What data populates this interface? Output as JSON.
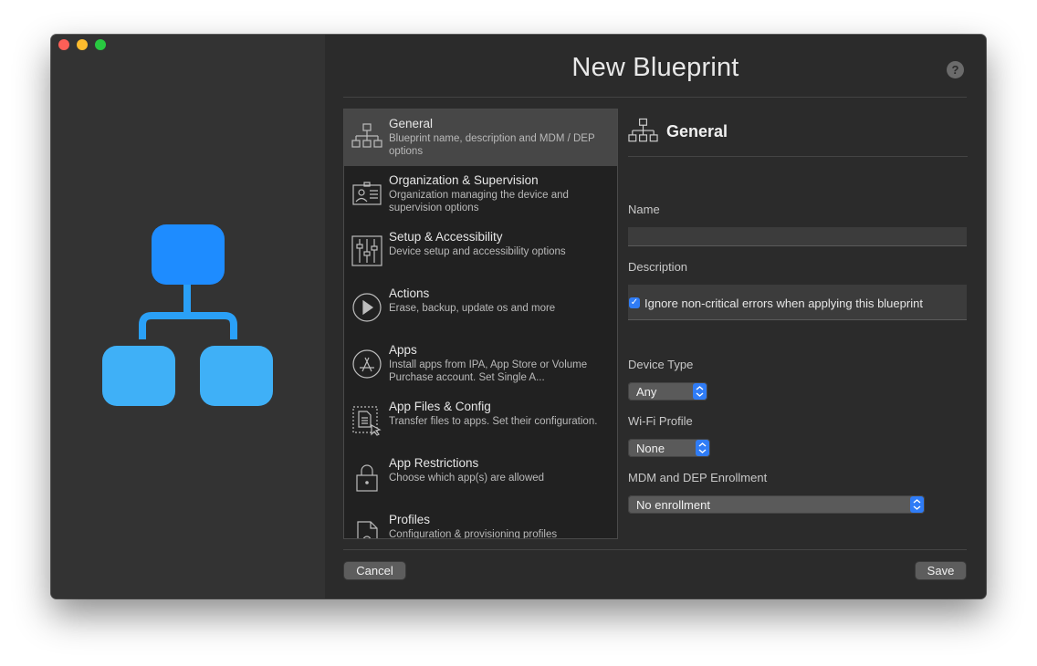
{
  "window": {
    "title": "New Blueprint",
    "help_label": "?"
  },
  "sidebar": {
    "items": [
      {
        "title": "General",
        "description": "Blueprint name, description and MDM / DEP options",
        "icon": "hierarchy-icon",
        "selected": true
      },
      {
        "title": "Organization & Supervision",
        "description": "Organization managing the device and supervision options",
        "icon": "id-card-icon"
      },
      {
        "title": "Setup & Accessibility",
        "description": "Device setup and accessibility options",
        "icon": "sliders-icon"
      },
      {
        "title": "Actions",
        "description": "Erase, backup, update os and more",
        "icon": "play-icon"
      },
      {
        "title": "Apps",
        "description": "Install apps from IPA, App Store or Volume Purchase account. Set Single A...",
        "icon": "app-store-icon"
      },
      {
        "title": "App Files & Config",
        "description": "Transfer files to apps. Set their configuration.",
        "icon": "file-transfer-icon"
      },
      {
        "title": "App Restrictions",
        "description": "Choose which app(s) are allowed",
        "icon": "lock-icon"
      },
      {
        "title": "Profiles",
        "description": "Configuration & provisioning profiles",
        "icon": "profile-gear-icon"
      }
    ]
  },
  "detail": {
    "header": "General",
    "name_label": "Name",
    "name_value": "",
    "description_label": "Description",
    "description_value": "",
    "ignore_errors_label": "Ignore non-critical errors when applying this blueprint",
    "ignore_errors_checked": true,
    "device_type_label": "Device Type",
    "device_type_value": "Any",
    "wifi_label": "Wi-Fi Profile",
    "wifi_value": "None",
    "enrollment_label": "MDM and DEP Enrollment",
    "enrollment_value": "No enrollment"
  },
  "footer": {
    "cancel_label": "Cancel",
    "save_label": "Save"
  },
  "colors": {
    "accent": "#2f7cf6",
    "hero_top": "#1e90ff",
    "hero_bottom": "#3aa8f5"
  }
}
